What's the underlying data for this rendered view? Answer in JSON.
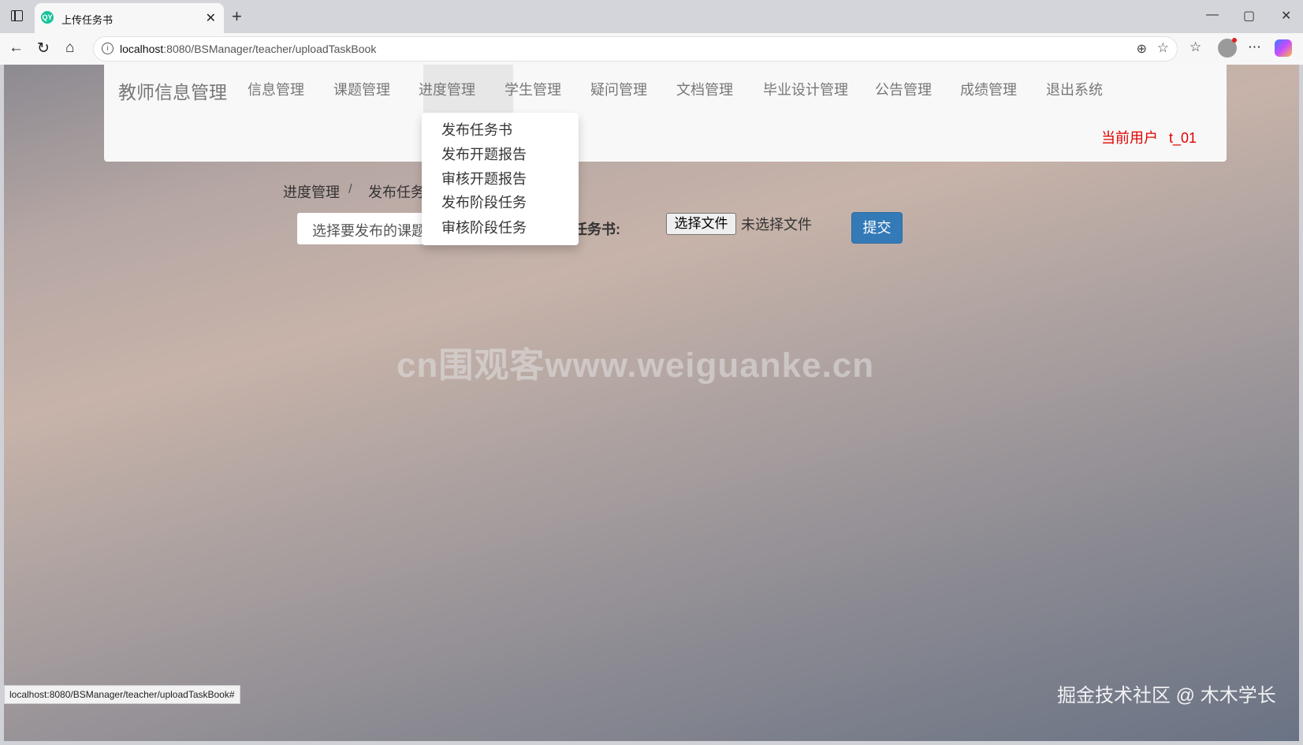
{
  "browser": {
    "tab_title": "上传任务书",
    "tab_favicon": "QY",
    "url_host": "localhost",
    "url_path": ":8080/BSManager/teacher/uploadTaskBook",
    "status_url": "localhost:8080/BSManager/teacher/uploadTaskBook#"
  },
  "nav": {
    "brand": "教师信息管理",
    "items": [
      "信息管理",
      "课题管理",
      "进度管理",
      "学生管理",
      "疑问管理",
      "文档管理",
      "毕业设计管理",
      "公告管理",
      "成绩管理",
      "退出系统"
    ],
    "active": "进度管理",
    "user_label": "当前用户",
    "user_name": "t_01"
  },
  "dropdown": [
    "发布任务书",
    "发布开题报告",
    "审核开题报告",
    "发布阶段任务",
    "审核阶段任务"
  ],
  "breadcrumb": {
    "parent": "进度管理",
    "separator": "/",
    "current": "发布任务"
  },
  "form": {
    "select_text": "选择要发布的课题",
    "label": "任务书:",
    "file_button": "选择文件",
    "file_status": "未选择文件",
    "submit": "提交"
  },
  "watermark": "cn围观客www.weiguanke.cn",
  "juejin_watermark": "掘金技术社区 @ 木木学长",
  "colors": {
    "submit": "#337ab7",
    "user": "#e00000"
  }
}
